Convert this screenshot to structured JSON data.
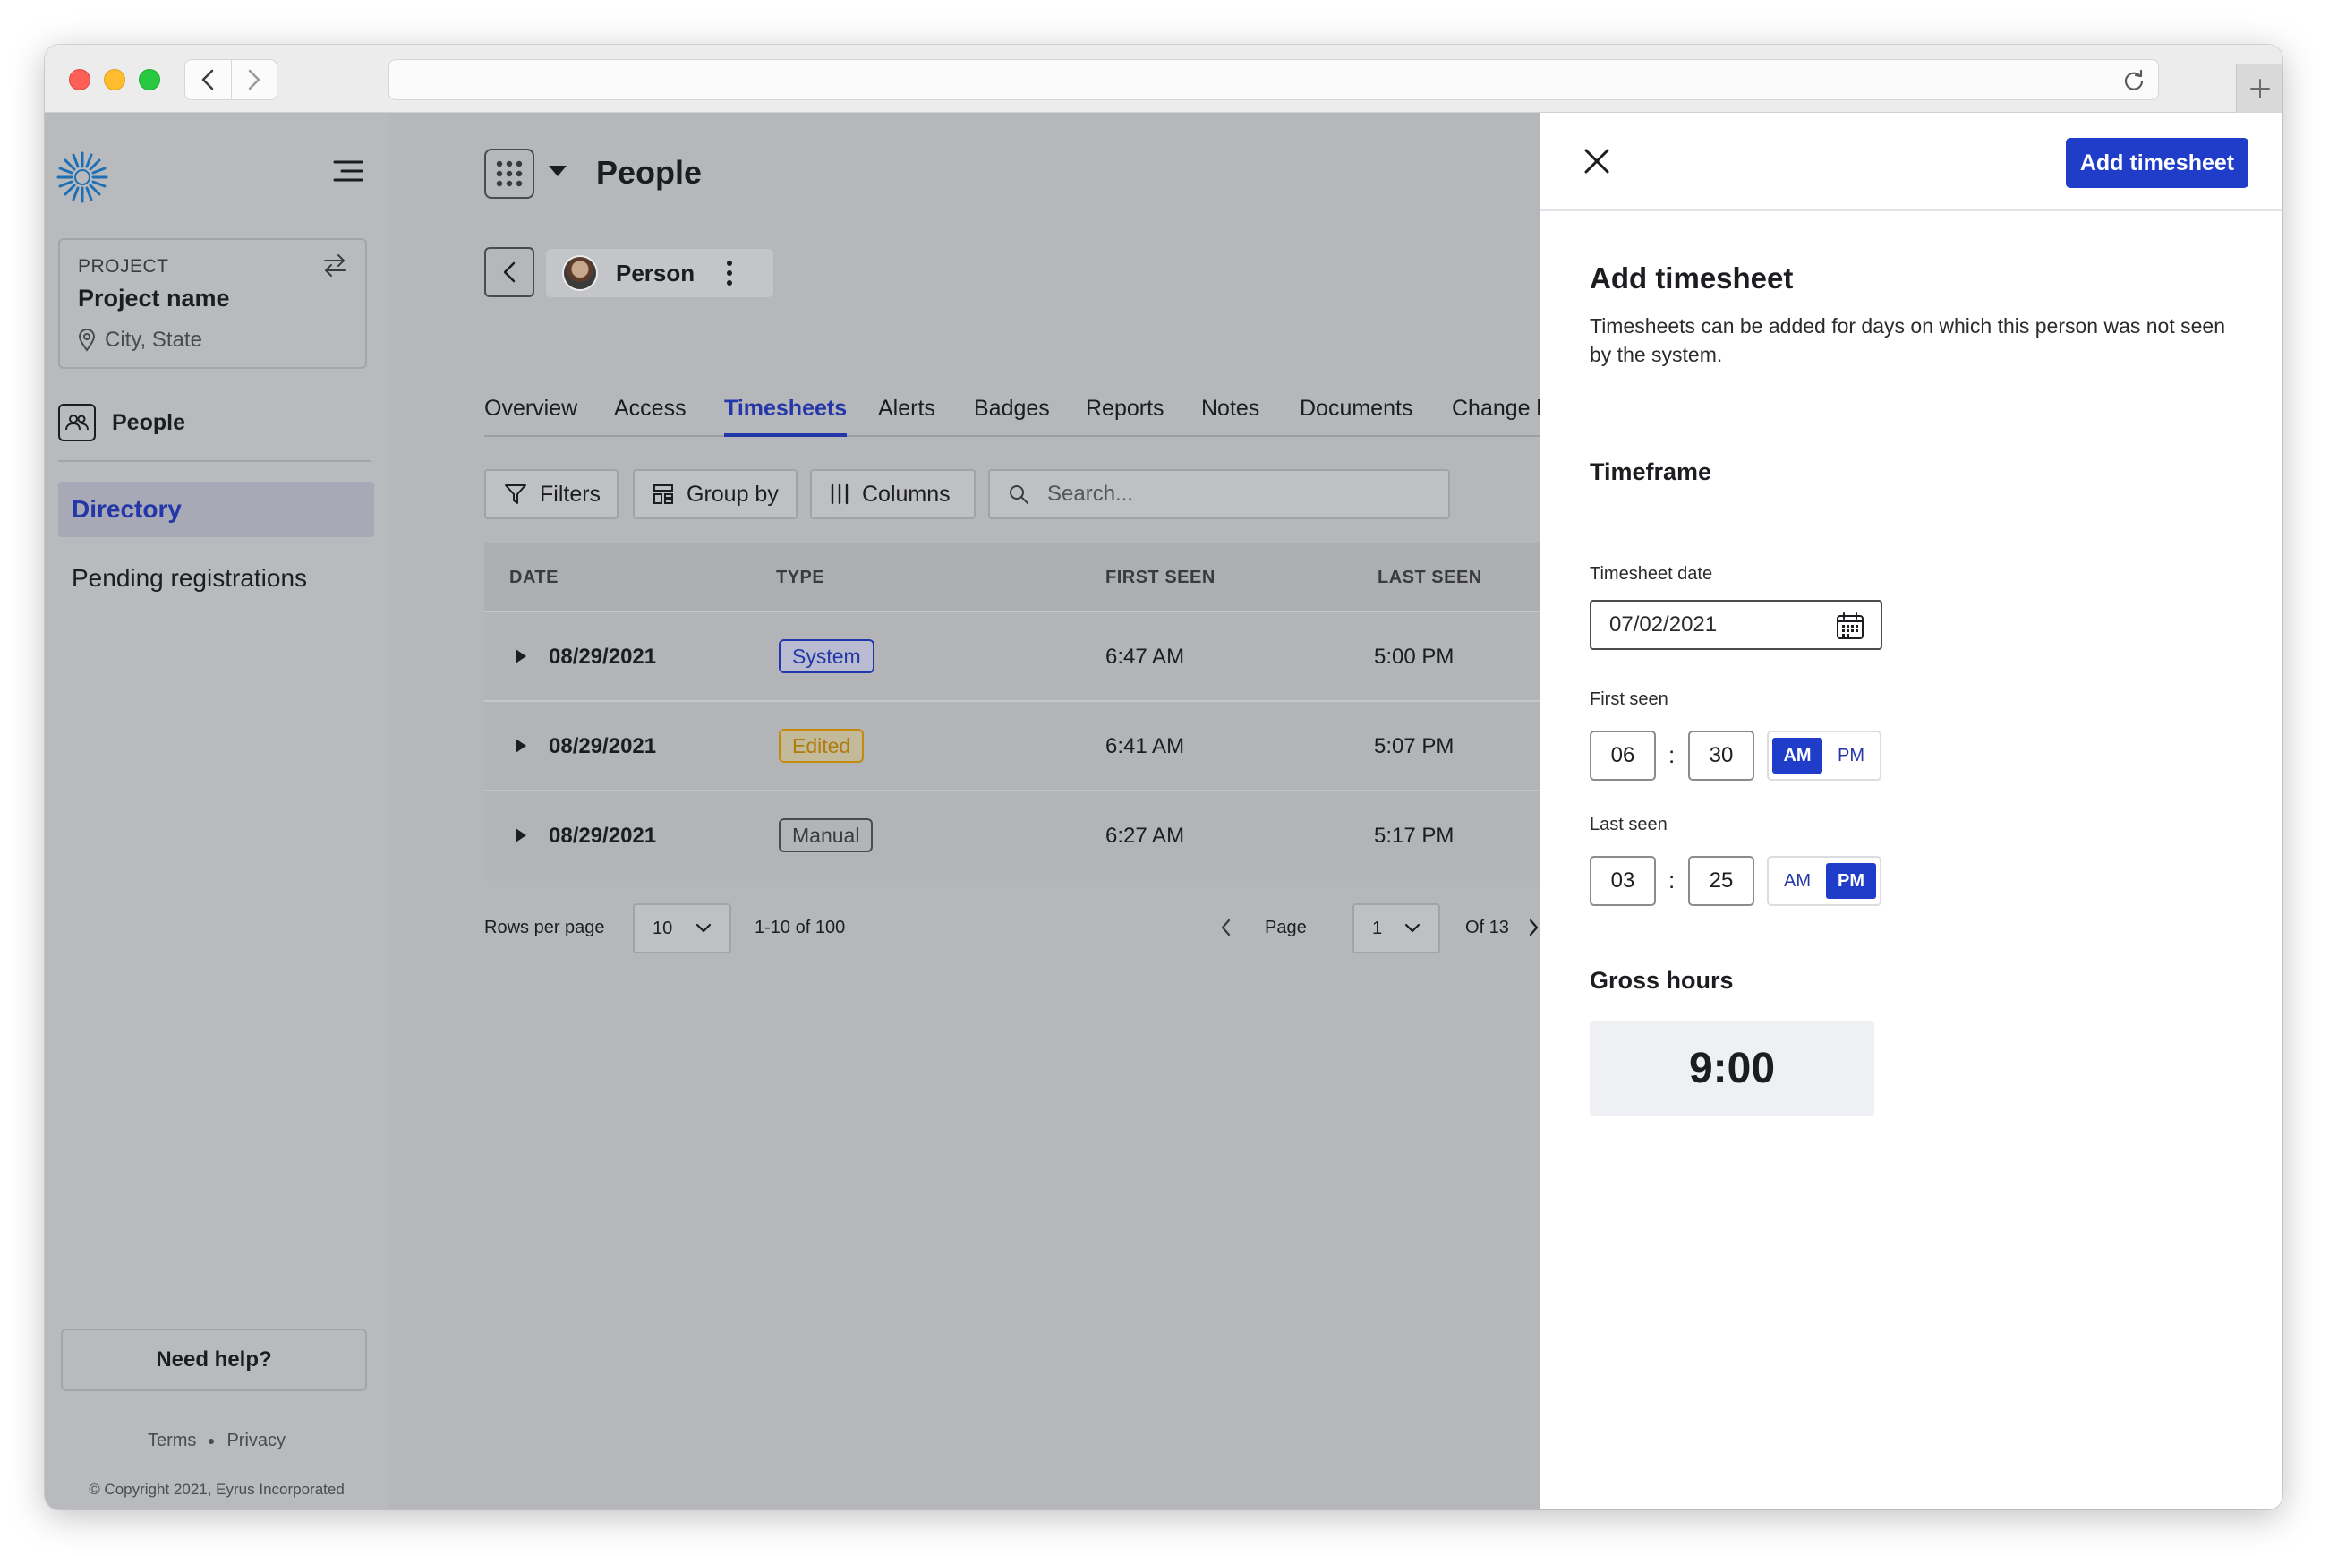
{
  "sidebar": {
    "project": {
      "eyebrow": "PROJECT",
      "name": "Project name",
      "location": "City, State"
    },
    "section_label": "People",
    "items": [
      {
        "label": "Directory",
        "active": true
      },
      {
        "label": "Pending registrations",
        "active": false
      }
    ],
    "help_label": "Need help?",
    "footer_links": [
      "Terms",
      "Privacy"
    ],
    "copyright": "© Copyright 2021, Eyrus Incorporated"
  },
  "main": {
    "page_title": "People",
    "person_name": "Person",
    "tabs": [
      {
        "label": "Overview",
        "active": false
      },
      {
        "label": "Access",
        "active": false
      },
      {
        "label": "Timesheets",
        "active": true
      },
      {
        "label": "Alerts",
        "active": false
      },
      {
        "label": "Badges",
        "active": false
      },
      {
        "label": "Reports",
        "active": false
      },
      {
        "label": "Notes",
        "active": false
      },
      {
        "label": "Documents",
        "active": false
      },
      {
        "label": "Change log",
        "active": false
      }
    ],
    "toolbar": {
      "filters": "Filters",
      "group_by": "Group by",
      "columns": "Columns",
      "search_placeholder": "Search..."
    },
    "table": {
      "headers": [
        "DATE",
        "TYPE",
        "FIRST SEEN",
        "LAST SEEN"
      ],
      "rows": [
        {
          "date": "08/29/2021",
          "type": "System",
          "first_seen": "6:47 AM",
          "last_seen": "5:00 PM"
        },
        {
          "date": "08/29/2021",
          "type": "Edited",
          "first_seen": "6:41 AM",
          "last_seen": "5:07 PM"
        },
        {
          "date": "08/29/2021",
          "type": "Manual",
          "first_seen": "6:27 AM",
          "last_seen": "5:17 PM"
        }
      ]
    },
    "pagination": {
      "rows_label": "Rows per page",
      "rows_value": "10",
      "range": "1-10 of 100",
      "page_label": "Page",
      "page_value": "1",
      "of_label": "Of 13"
    }
  },
  "panel": {
    "primary_button": "Add timesheet",
    "title": "Add timesheet",
    "description": "Timesheets can be added for days on which this person was not seen by the system.",
    "timeframe_heading": "Timeframe",
    "date_label": "Timesheet date",
    "date_value": "07/02/2021",
    "first_seen": {
      "label": "First seen",
      "hour": "06",
      "minute": "30",
      "am": "AM",
      "pm": "PM",
      "selected": "AM"
    },
    "last_seen": {
      "label": "Last seen",
      "hour": "03",
      "minute": "25",
      "am": "AM",
      "pm": "PM",
      "selected": "PM"
    },
    "gross_heading": "Gross hours",
    "gross_value": "9:00",
    "separator": ":"
  },
  "colors": {
    "accent": "#1f3dc8",
    "edited": "#c48a0c",
    "overlay": "#b6b7ba"
  }
}
